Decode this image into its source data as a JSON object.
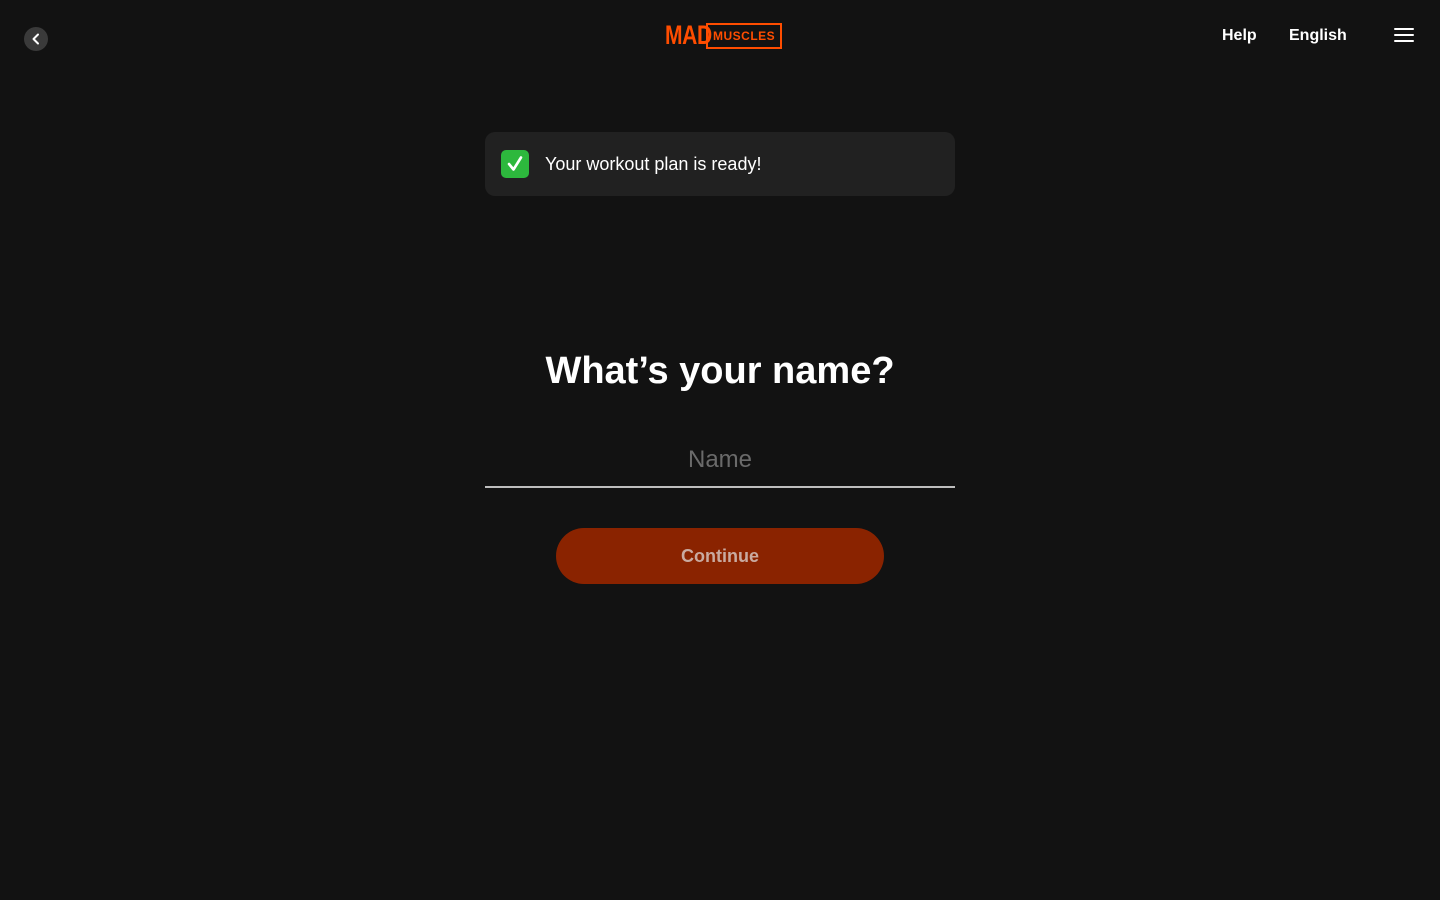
{
  "header": {
    "back_icon": "chevron-left-icon",
    "logo": {
      "part1": "MAD",
      "part2": "MUSCLES",
      "color": "#ff4d00"
    },
    "help_label": "Help",
    "language_label": "English",
    "menu_icon": "hamburger-menu-icon"
  },
  "notice": {
    "icon": "check-mark-icon",
    "text": "Your workout plan is ready!"
  },
  "form": {
    "question": "What’s your name?",
    "name_value": "",
    "name_placeholder": "Name",
    "continue_label": "Continue",
    "continue_color": "#8a2300"
  }
}
